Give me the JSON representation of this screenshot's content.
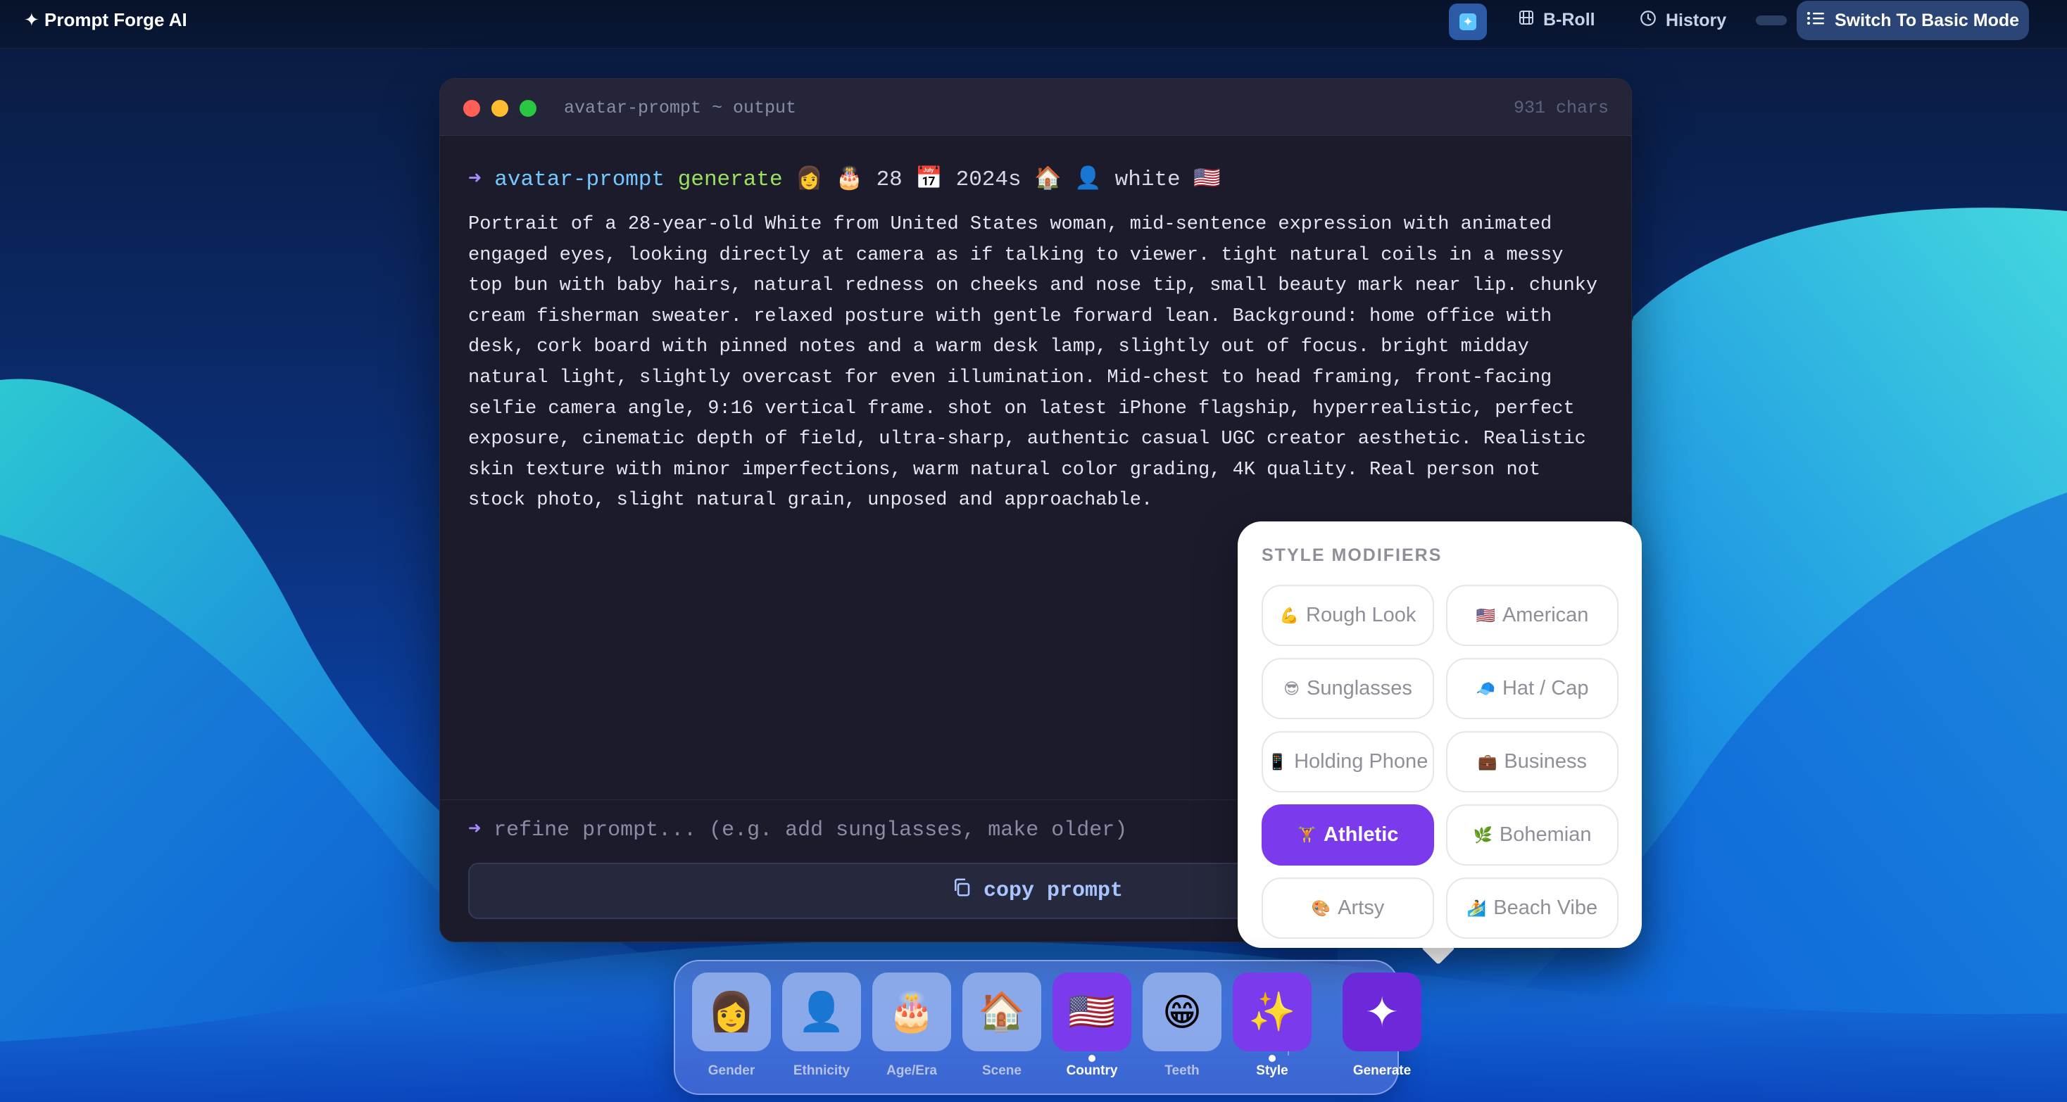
{
  "topbar": {
    "brand": "✦ Prompt Forge AI",
    "broll_label": "B-Roll",
    "history_label": "History",
    "mode_button_label": "Switch To Basic Mode"
  },
  "terminal": {
    "title": "avatar-prompt ~ output",
    "char_count": "931 chars",
    "command": {
      "arrow": "➜",
      "program": "avatar-prompt",
      "subcommand": "generate",
      "args": "👩 🎂 28 📅 2024s 🏠 👤 white 🇺🇸"
    },
    "output_text": "Portrait of a 28-year-old White from United States woman, mid-sentence expression with animated engaged eyes, looking directly at camera as if talking to viewer. tight natural coils in a messy top bun with baby hairs, natural redness on cheeks and nose tip, small beauty mark near lip. chunky cream fisherman sweater. relaxed posture with gentle forward lean. Background: home office with desk, cork board with pinned notes and a warm desk lamp, slightly out of focus. bright midday natural light, slightly overcast for even illumination. Mid-chest to head framing, front-facing selfie camera angle, 9:16 vertical frame. shot on latest iPhone flagship, hyperrealistic, perfect exposure, cinematic depth of field, ultra-sharp, authentic casual UGC creator aesthetic. Realistic skin texture with minor imperfections, warm natural color grading, 4K quality. Real person not stock photo, slight natural grain, unposed and approachable.",
    "refine_placeholder": "refine prompt... (e.g. add sunglasses, make older)",
    "copy_label": "copy prompt"
  },
  "style_modifiers": {
    "title": "STYLE MODIFIERS",
    "chips": [
      {
        "emoji": "💪",
        "label": "Rough Look",
        "active": false
      },
      {
        "emoji": "🇺🇸",
        "label": "American",
        "active": false
      },
      {
        "emoji": "😎",
        "label": "Sunglasses",
        "active": false
      },
      {
        "emoji": "🧢",
        "label": "Hat / Cap",
        "active": false
      },
      {
        "emoji": "📱",
        "label": "Holding Phone",
        "active": false
      },
      {
        "emoji": "💼",
        "label": "Business",
        "active": false
      },
      {
        "emoji": "🏋",
        "label": "Athletic",
        "active": true
      },
      {
        "emoji": "🌿",
        "label": "Bohemian",
        "active": false
      },
      {
        "emoji": "🎨",
        "label": "Artsy",
        "active": false
      },
      {
        "emoji": "🏄",
        "label": "Beach Vibe",
        "active": false
      }
    ]
  },
  "dock": {
    "items": [
      {
        "icon": "👩",
        "label": "Gender"
      },
      {
        "icon": "👤",
        "label": "Ethnicity"
      },
      {
        "icon": "🎂",
        "label": "Age/Era"
      },
      {
        "icon": "🏠",
        "label": "Scene"
      },
      {
        "icon": "🇺🇸",
        "label": "Country"
      },
      {
        "icon": "😁",
        "label": "Teeth"
      },
      {
        "icon": "✨",
        "label": "Style"
      },
      {
        "icon": "✦",
        "label": "Generate"
      }
    ]
  },
  "colors": {
    "accent": "#7c3aed",
    "terminal_bg": "#1b1b2c",
    "prompt_blue": "#74c7ff",
    "prompt_green": "#9be15d"
  }
}
